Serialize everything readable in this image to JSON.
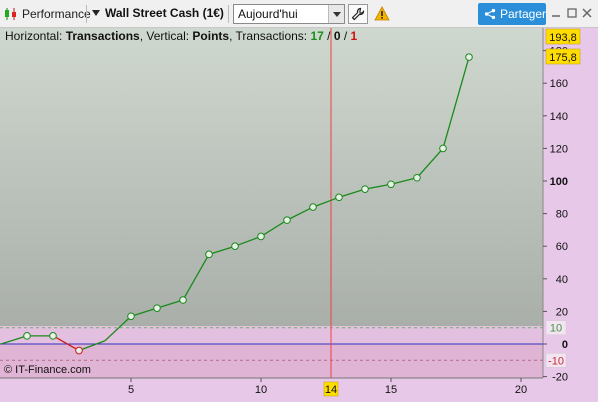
{
  "toolbar": {
    "performance_label": "Performance",
    "instrument_label": "Wall Street Cash (1€)",
    "period_value": "Aujourd'hui",
    "share_label": "Partager"
  },
  "info": {
    "prefix": "Horizontal: ",
    "horizontal": "Transactions",
    "mid": ", Vertical: ",
    "vertical": "Points",
    "suffix": ", Transactions: ",
    "count_total": "17",
    "slash1": " / ",
    "count_zero": "0",
    "slash2": " / ",
    "count_loss": "1"
  },
  "watermark": "© IT-Finance.com",
  "colors": {
    "gain_line": "#1a8a1a",
    "loss_line": "#d01818",
    "cursor_line": "#f04040",
    "zero_line": "#3030c0",
    "badge": "#ffdd00"
  },
  "chart_data": {
    "type": "line",
    "title": "",
    "xlabel": "Transactions",
    "ylabel": "Points",
    "xlim": [
      0,
      21
    ],
    "ylim": [
      -20,
      200
    ],
    "x_ticks": [
      5,
      10,
      15,
      20
    ],
    "y_ticks": [
      -20,
      0,
      20,
      40,
      60,
      80,
      100,
      120,
      140,
      160,
      180
    ],
    "y_tick_labels": [
      "-20",
      "0",
      "20",
      "40",
      "60",
      "80",
      "100",
      "120",
      "140",
      "160",
      "180"
    ],
    "threshold_lines": [
      {
        "value": 10,
        "label": "10"
      },
      {
        "value": -10,
        "label": "-10"
      }
    ],
    "cursor_x": 14,
    "cursor_label": "14",
    "badges": [
      {
        "value": 193.8,
        "label": "193,8"
      },
      {
        "value": 175.8,
        "label": "175,8"
      }
    ],
    "series": [
      {
        "x": [
          0,
          1,
          2,
          3,
          4,
          5,
          6,
          7,
          8,
          9,
          10,
          11,
          12,
          13,
          14,
          15,
          16,
          17,
          18
        ],
        "y": [
          0,
          5,
          5,
          -4,
          2,
          17,
          22,
          27,
          55,
          60,
          66,
          76,
          84,
          90,
          95,
          98,
          102,
          120,
          176
        ],
        "markers": [
          false,
          true,
          true,
          true,
          false,
          true,
          true,
          true,
          true,
          true,
          true,
          true,
          true,
          true,
          true,
          true,
          true,
          true,
          true
        ]
      }
    ]
  }
}
